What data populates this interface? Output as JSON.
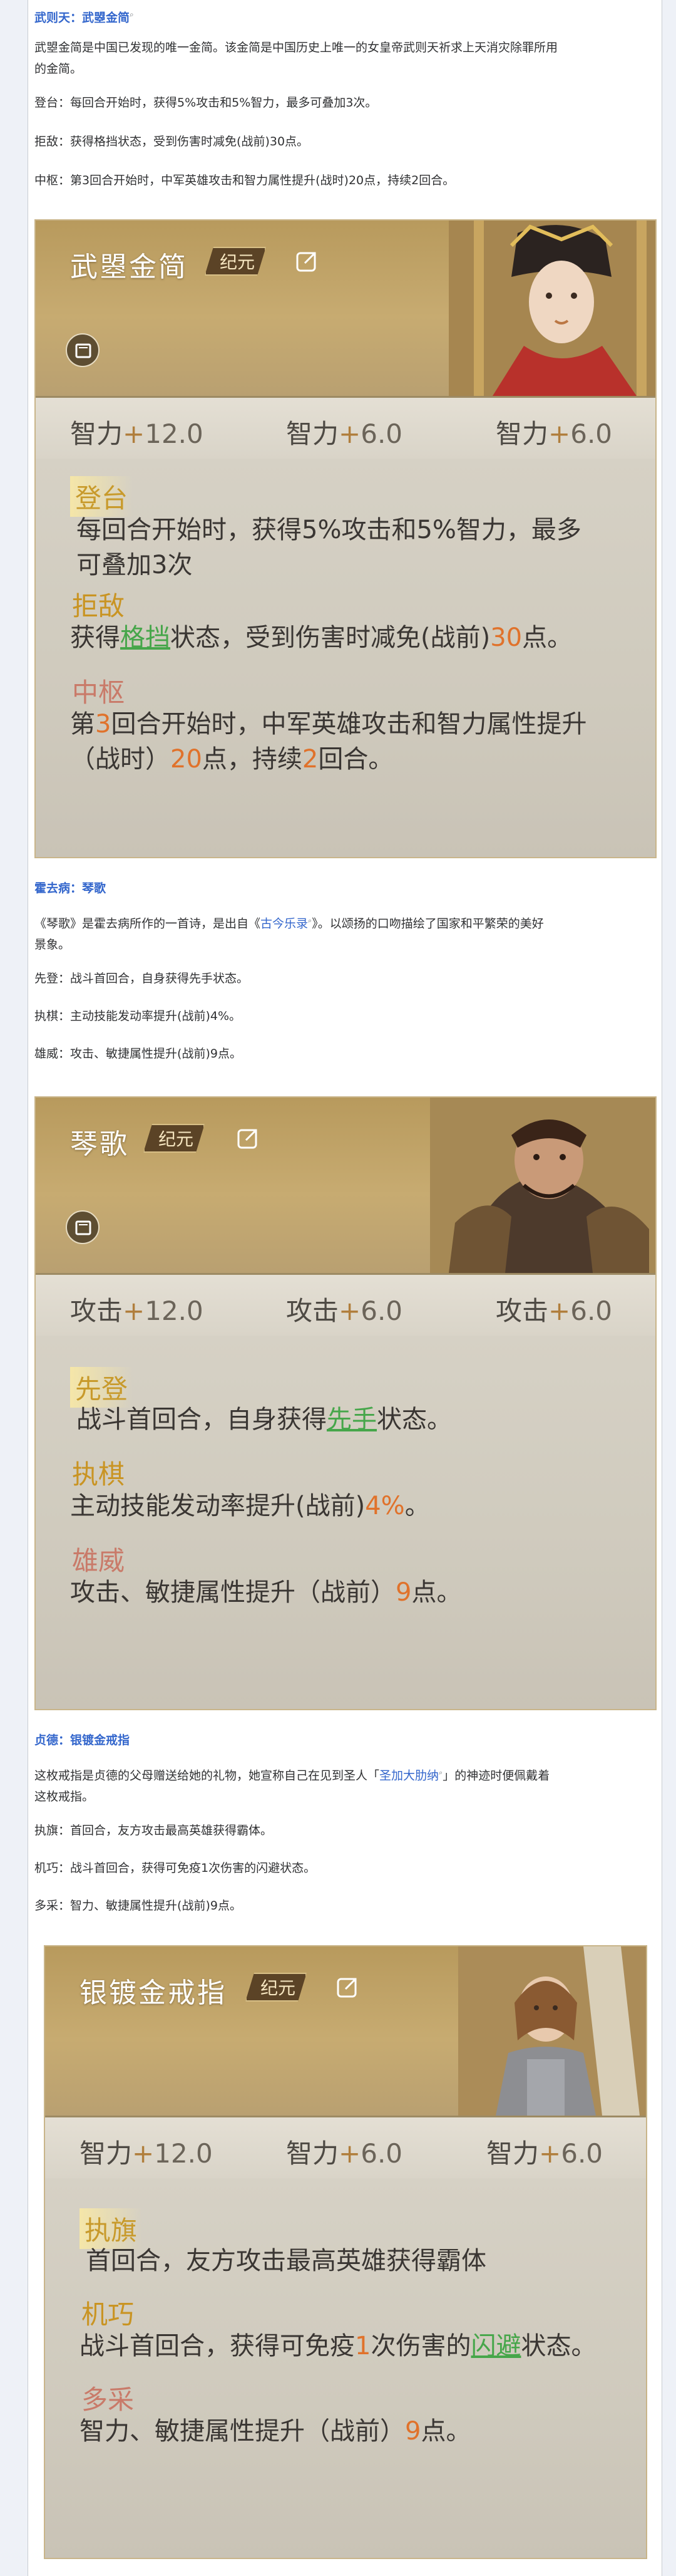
{
  "colors": {
    "link": "#3366cc",
    "gold": "#c89a2b",
    "green": "#46a64a",
    "orange": "#e0722b",
    "rose": "#c97a69"
  },
  "sections": [
    {
      "hero": "武则天",
      "item": "武曌金简",
      "intro": "武曌金简是中国已发现的唯一金简。该金简是中国历史上唯一的女皇帝武则天祈求上天消灾除罪所用的金简。",
      "intro_line1": "武曌金简是中国已发现的唯一金简。该金简是中国历史上唯一的女皇帝武则天祈求上天消灾除罪所用",
      "intro_line2": "的金简。",
      "skills": [
        {
          "label": "登台",
          "text": "每回合开始时，获得5%攻击和5%智力，最多可叠加3次。"
        },
        {
          "label": "拒敌",
          "text": "获得格挡状态，受到伤害时减免(战前)30点。"
        },
        {
          "label": "中枢",
          "text": "第3回合开始时，中军英雄攻击和智力属性提升(战时)20点，持续2回合。"
        }
      ],
      "card": {
        "title": "武曌金简",
        "era": "纪元",
        "stats": [
          {
            "name": "智力",
            "plus": "+",
            "value": "12.0"
          },
          {
            "name": "智力",
            "plus": "+",
            "value": "6.0"
          },
          {
            "name": "智力",
            "plus": "+",
            "value": "6.0"
          }
        ],
        "skills": [
          {
            "label": "登台",
            "lines": [
              "每回合开始时，获得5%攻击和5%智力，最多",
              "可叠加3次"
            ]
          },
          {
            "label": "拒敌",
            "pre": "获得",
            "hl": "格挡",
            "mid": "状态，受到伤害时减免(战前)",
            "num": "30",
            "post": "点。"
          },
          {
            "label": "中枢",
            "l1_pre": "第",
            "l1_num": "3",
            "l1_post": "回合开始时，中军英雄攻击和智力属性提升",
            "l2_pre": "（战时）",
            "l2_num": "20",
            "l2_mid": "点，持续",
            "l2_num2": "2",
            "l2_post": "回合。"
          }
        ]
      }
    },
    {
      "hero": "霍去病",
      "item": "琴歌",
      "intro_line1_pre": "《琴歌》是霍去病所作的一首诗，是出自《",
      "intro_link": "古今乐录",
      "intro_line1_post": "》。以颂扬的口吻描绘了国家和平繁荣的美好",
      "intro_line2": "景象。",
      "skills": [
        {
          "label": "先登",
          "text": "战斗首回合，自身获得先手状态。"
        },
        {
          "label": "执棋",
          "text": "主动技能发动率提升(战前)4%。"
        },
        {
          "label": "雄威",
          "text": "攻击、敏捷属性提升(战前)9点。"
        }
      ],
      "card": {
        "title": "琴歌",
        "era": "纪元",
        "stats": [
          {
            "name": "攻击",
            "plus": "+",
            "value": "12.0"
          },
          {
            "name": "攻击",
            "plus": "+",
            "value": "6.0"
          },
          {
            "name": "攻击",
            "plus": "+",
            "value": "6.0"
          }
        ],
        "skills": [
          {
            "label": "先登",
            "pre": "战斗首回合，自身获得",
            "hl": "先手",
            "post": "状态。"
          },
          {
            "label": "执棋",
            "pre": "主动技能发动率提升(战前)",
            "num": "4%",
            "post": "。"
          },
          {
            "label": "雄威",
            "pre": "攻击、敏捷属性提升（战前）",
            "num": "9",
            "post": "点。"
          }
        ]
      }
    },
    {
      "hero": "贞德",
      "item": "银镀金戒指",
      "intro_line1_pre": "这枚戒指是贞德的父母赠送给她的礼物，她宣称自己在见到圣人「",
      "intro_link": "圣加大肋纳",
      "intro_line1_post": "」的神迹时便佩戴着",
      "intro_line2": "这枚戒指。",
      "skills": [
        {
          "label": "执旗",
          "text": "首回合，友方攻击最高英雄获得霸体。"
        },
        {
          "label": "机巧",
          "text": "战斗首回合，获得可免疫1次伤害的闪避状态。"
        },
        {
          "label": "多采",
          "text": "智力、敏捷属性提升(战前)9点。"
        }
      ],
      "card": {
        "title": "银镀金戒指",
        "era": "纪元",
        "stats": [
          {
            "name": "智力",
            "plus": "+",
            "value": "12.0"
          },
          {
            "name": "智力",
            "plus": "+",
            "value": "6.0"
          },
          {
            "name": "智力",
            "plus": "+",
            "value": "6.0"
          }
        ],
        "skills": [
          {
            "label": "执旗",
            "text": "首回合，友方攻击最高英雄获得霸体"
          },
          {
            "label": "机巧",
            "pre": "战斗首回合，获得可免疫",
            "num": "1",
            "mid": "次伤害的",
            "hl": "闪避",
            "post": "状态。"
          },
          {
            "label": "多采",
            "pre": "智力、敏捷属性提升（战前）",
            "num": "9",
            "post": "点。"
          }
        ]
      }
    }
  ],
  "separator": "：",
  "icons": [
    "search-icon",
    "share-icon",
    "book-icon"
  ]
}
